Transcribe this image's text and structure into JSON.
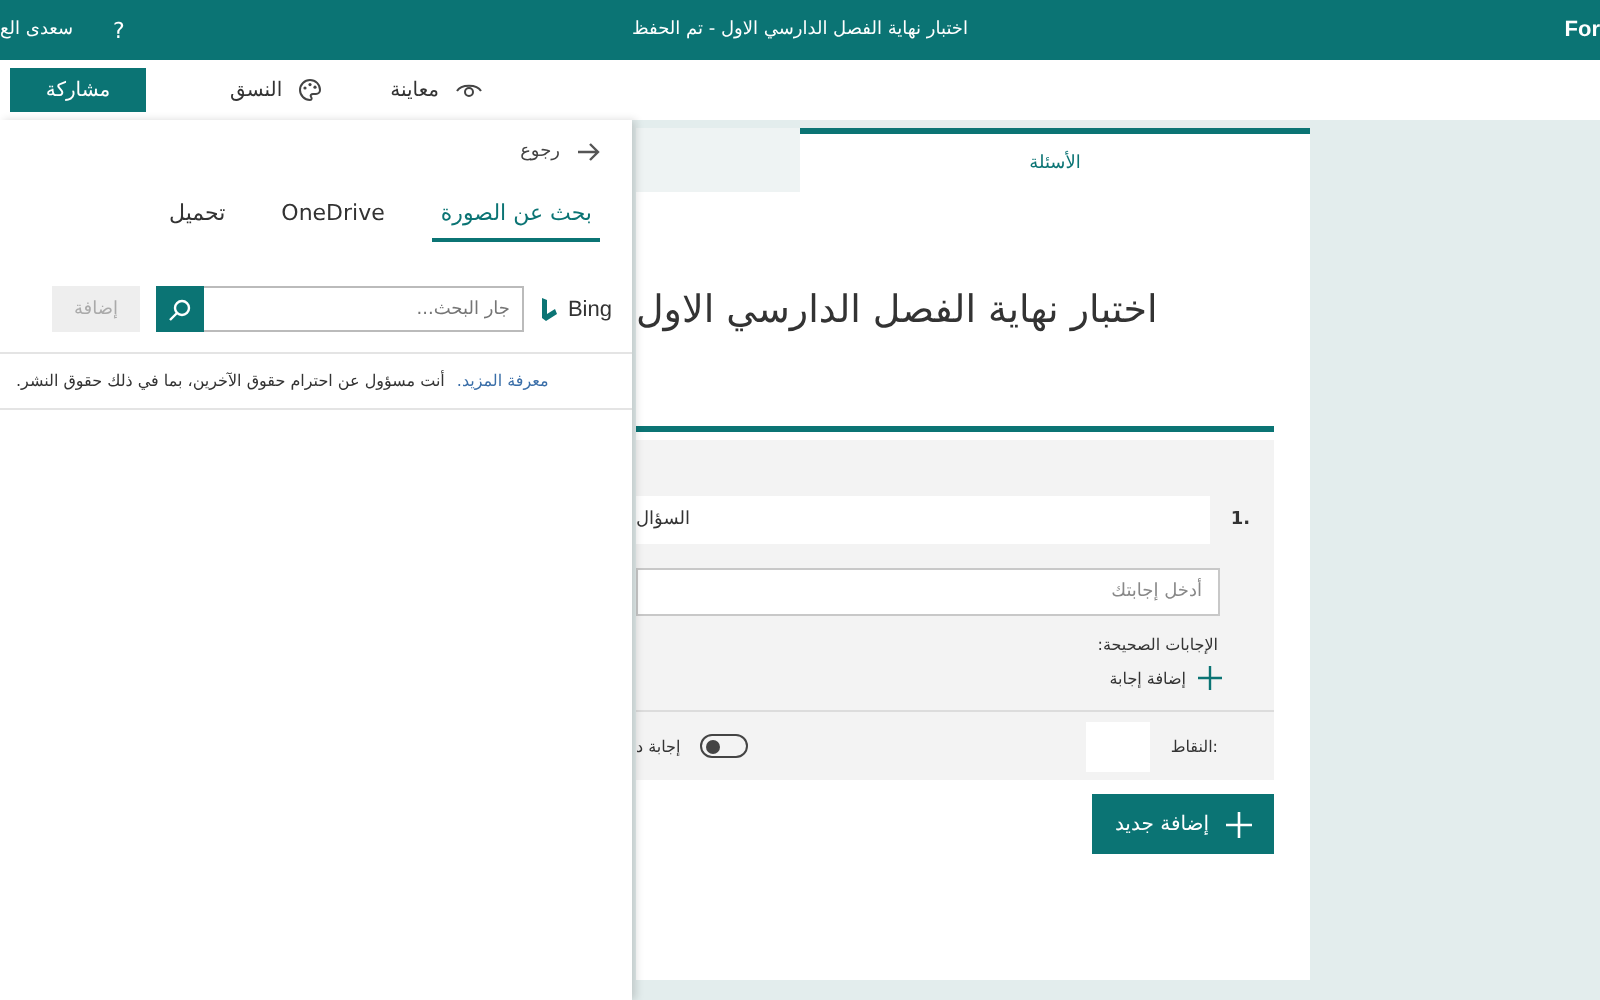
{
  "top_bar": {
    "user_name": "سعدى الع",
    "help": "?",
    "title": "اختبار نهاية الفصل الدارسي الاول - تم الحفظ",
    "app_name": "For"
  },
  "toolbar": {
    "share": "مشاركة",
    "items": [
      {
        "kind": "preview",
        "label": "معاينة"
      },
      {
        "kind": "theme",
        "label": "النسق"
      }
    ]
  },
  "image_panel": {
    "back": "رجوع",
    "tabs": [
      {
        "label": "بحث عن الصورة",
        "selected": true
      },
      {
        "label": "OneDrive",
        "selected": false
      },
      {
        "label": "تحميل",
        "selected": false
      }
    ],
    "search": {
      "provider": "Bing",
      "placeholder": "جار البحث...",
      "add_button": "إضافة",
      "add_disabled": true
    },
    "notice": "أنت مسؤول عن احترام حقوق الآخرين، بما في ذلك حقوق النشر.",
    "learn_more": "معرفة المزيد."
  },
  "form": {
    "tab": "الأسئلة",
    "title": "اختبار نهاية الفصل الدارسي الاول",
    "question": {
      "number": "1.",
      "text": "السؤال",
      "answer_placeholder": "أدخل إجابتك",
      "correct_answers": "الإجابات الصحيحة:",
      "add_answer": "إضافة إجابة",
      "points_label": "النقاط:",
      "multiple_answers": {
        "label": "إجابة د",
        "on": false
      }
    },
    "add_new": "إضافة جديد"
  }
}
